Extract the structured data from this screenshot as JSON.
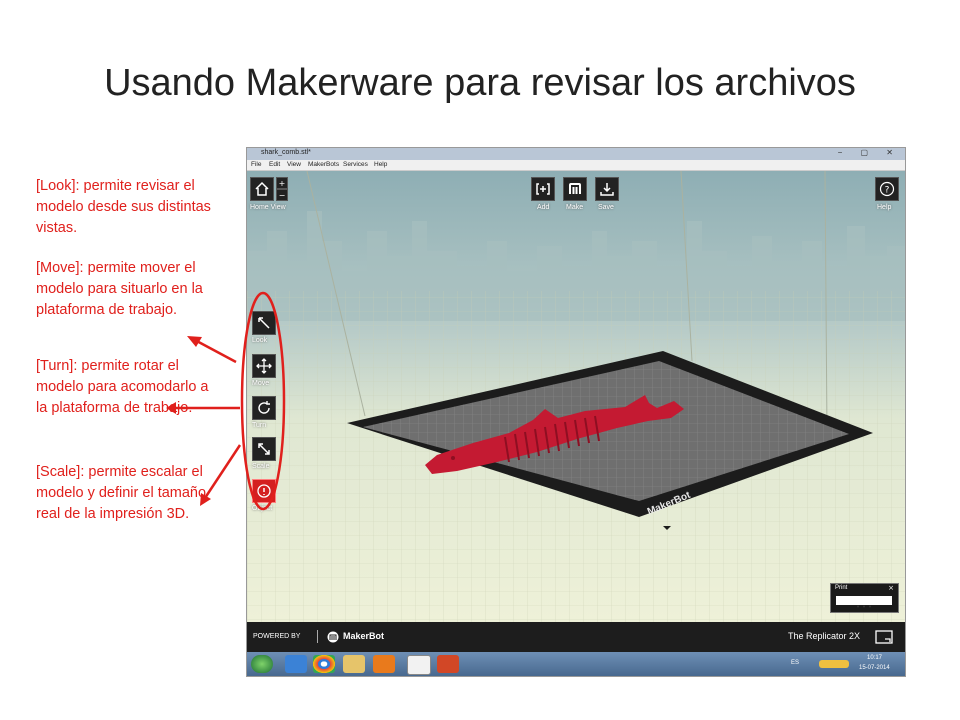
{
  "slide": {
    "title": "Usando Makerware para revisar los archivos"
  },
  "notes": {
    "look": "[Look]: permite revisar el modelo desde sus distintas vistas.",
    "move": "[Move]: permite mover el modelo para situarlo en la plataforma de trabajo.",
    "turn": "[Turn]: permite rotar el modelo para acomodarlo a la plataforma de trabajo.",
    "scale": "[Scale]: permite escalar el modelo y definir el tamaño real de la impresión 3D."
  },
  "app": {
    "window_title": "shark_comb.stl*",
    "menu": [
      "File",
      "Edit",
      "View",
      "MakerBots",
      "Services",
      "Help"
    ],
    "home_view_label": "Home View",
    "zoom_in": "+",
    "zoom_out": "−",
    "top_buttons": {
      "add": "Add",
      "make": "Make",
      "save": "Save"
    },
    "help_label": "Help",
    "tools": {
      "look": "Look",
      "move": "Move",
      "turn": "Turn",
      "scale": "Scale",
      "object": "Object"
    },
    "platform_logo": "MakerBot",
    "print_panel": {
      "title": "Print",
      "close": "×"
    },
    "footer": {
      "powered_by": "POWERED BY",
      "brand": "MakerBot",
      "printer": "The Replicator 2X"
    }
  },
  "taskbar": {
    "lang": "ES",
    "time": "10:17",
    "date": "15-07-2014"
  },
  "colors": {
    "annotation": "#e0201c",
    "model": "#c41a32",
    "platform_dark": "#1c1c1c",
    "platform_grid": "#6f6f6f"
  }
}
